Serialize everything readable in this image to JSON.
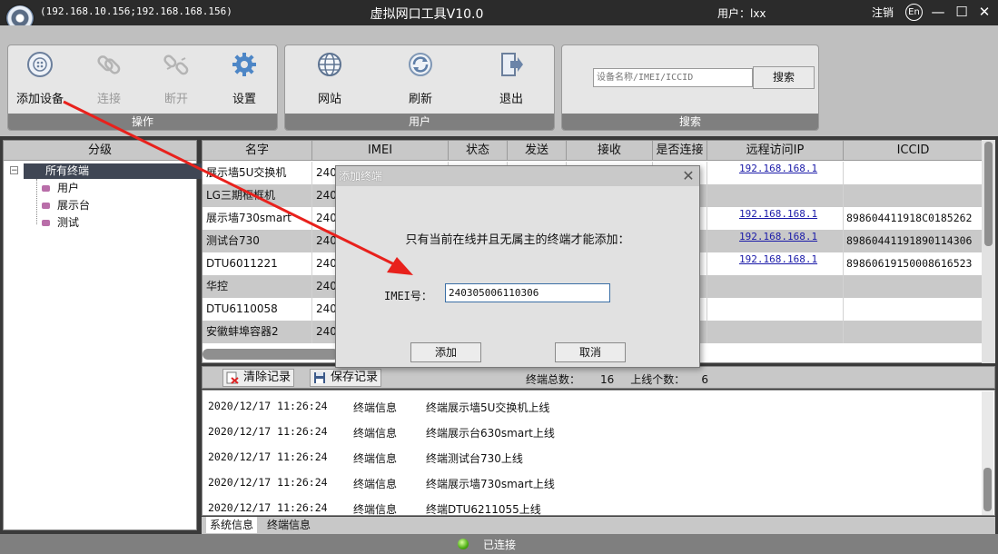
{
  "titlebar": {
    "ips": "(192.168.10.156;192.168.168.156)",
    "title": "虚拟网口工具V10.0",
    "user": "用户：lxx",
    "logout": "注销",
    "lang": "En",
    "minimize": "—",
    "maximize": "☐",
    "close": "✕"
  },
  "toolbar": {
    "ops": {
      "caption": "操作",
      "add": "添加设备",
      "connect": "连接",
      "disconnect": "断开",
      "settings": "设置"
    },
    "user": {
      "caption": "用户",
      "website": "网站",
      "refresh": "刷新",
      "exit": "退出"
    },
    "search": {
      "caption": "搜索",
      "placeholder": "设备名称/IMEI/ICCID",
      "button": "搜索"
    }
  },
  "tree": {
    "header": "分级",
    "root": "所有终端",
    "children": [
      "用户",
      "展示台",
      "测试"
    ]
  },
  "table": {
    "headers": [
      "名字",
      "IMEI",
      "状态",
      "发送",
      "接收",
      "是否连接",
      "远程访问IP",
      "ICCID"
    ],
    "rows": [
      {
        "name": "展示墙5U交换机",
        "imei": "240",
        "ip": "192.168.168.1",
        "iccid": ""
      },
      {
        "name": "LG三期框框机",
        "imei": "240",
        "ip": "",
        "iccid": ""
      },
      {
        "name": "展示墙730smart",
        "imei": "240",
        "ip": "192.168.168.1",
        "iccid": "898604411918C0185262"
      },
      {
        "name": "测试台730",
        "imei": "240",
        "ip": "192.168.168.1",
        "iccid": "89860441191890114306"
      },
      {
        "name": "DTU6011221",
        "imei": "240",
        "ip": "192.168.168.1",
        "iccid": "89860619150008616523"
      },
      {
        "name": "华控",
        "imei": "240",
        "ip": "",
        "iccid": ""
      },
      {
        "name": "DTU6110058",
        "imei": "240",
        "ip": "",
        "iccid": ""
      },
      {
        "name": "安徽蚌埠容器2",
        "imei": "240",
        "ip": "",
        "iccid": ""
      }
    ]
  },
  "dialog": {
    "title": "添加终端",
    "close": "✕",
    "message": "只有当前在线并且无属主的终端才能添加：",
    "imei_label": "IMEI号：",
    "imei_value": "240305006110306",
    "add": "添加",
    "cancel": "取消"
  },
  "log": {
    "clear": "清除记录",
    "save": "保存记录",
    "total_label": "终端总数：",
    "total": "16",
    "online_label": "上线个数：",
    "online": "6",
    "entries": [
      {
        "time": "2020/12/17 11:26:24",
        "type": "终端信息",
        "msg": "终端展示墙5U交换机上线"
      },
      {
        "time": "2020/12/17 11:26:24",
        "type": "终端信息",
        "msg": "终端展示台630smart上线"
      },
      {
        "time": "2020/12/17 11:26:24",
        "type": "终端信息",
        "msg": "终端测试台730上线"
      },
      {
        "time": "2020/12/17 11:26:24",
        "type": "终端信息",
        "msg": "终端展示墙730smart上线"
      },
      {
        "time": "2020/12/17 11:26:24",
        "type": "终端信息",
        "msg": "终端DTU6211055上线"
      }
    ],
    "tabs": [
      "系统信息",
      "终端信息"
    ]
  },
  "status": {
    "text": "已连接",
    "color": "#4caf12"
  },
  "annotation": {
    "arrow_color": "#e8211c"
  }
}
